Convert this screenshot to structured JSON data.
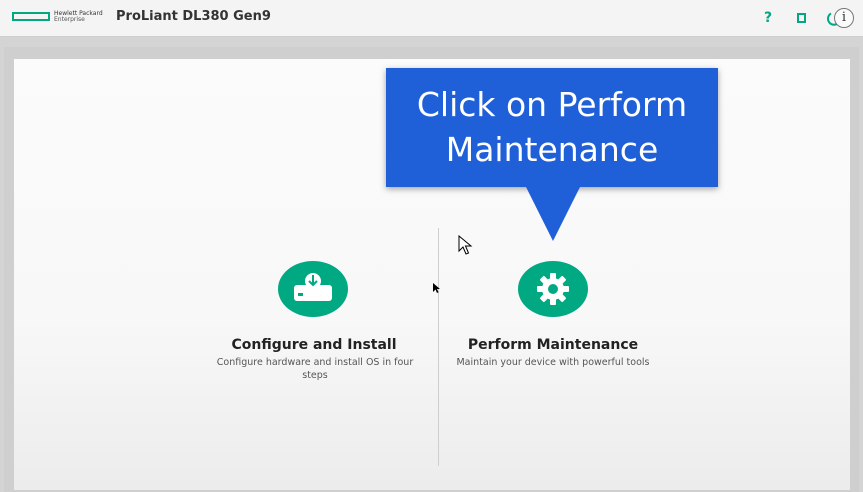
{
  "header": {
    "brand_line1": "Hewlett Packard",
    "brand_line2": "Enterprise",
    "product": "ProLiant DL380 Gen9",
    "help_label": "?",
    "info_label": "i"
  },
  "options": [
    {
      "title": "Configure and Install",
      "description": "Configure hardware and install OS in four steps",
      "icon": "drive-download-icon"
    },
    {
      "title": "Perform Maintenance",
      "description": "Maintain your device with powerful tools",
      "icon": "gear-icon"
    }
  ],
  "callout": {
    "text": "Click on Perform Maintenance"
  },
  "colors": {
    "accent": "#01a982",
    "callout": "#1f5fd8"
  }
}
